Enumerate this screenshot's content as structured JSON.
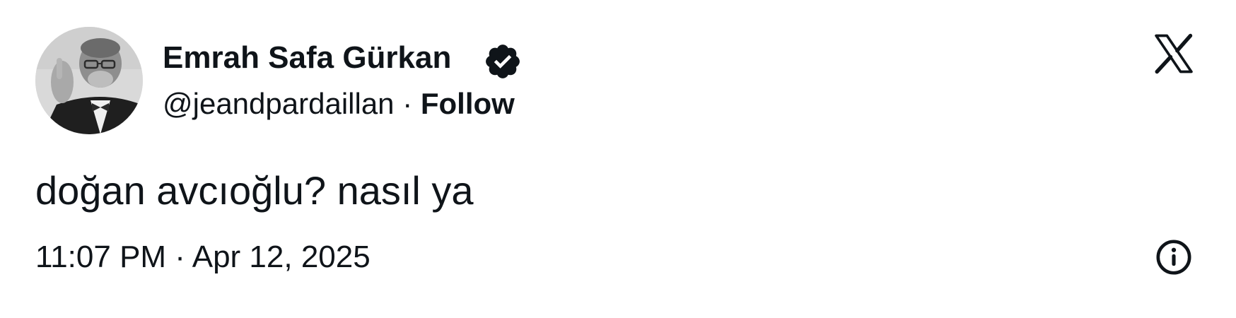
{
  "author": {
    "name": "Emrah Safa Gürkan",
    "handle": "@jeandpardaillan",
    "separator": "·",
    "follow_label": "Follow",
    "verified_icon": "verified-badge-icon",
    "avatar": "avatar"
  },
  "brand": {
    "logo_icon": "x-logo-icon"
  },
  "tweet": {
    "text": "doğan avcıoğlu? nasıl ya",
    "timestamp": "11:07 PM · Apr 12, 2025"
  },
  "footer": {
    "info_icon": "info-icon"
  },
  "colors": {
    "text": "#0f1419",
    "background": "#ffffff"
  }
}
